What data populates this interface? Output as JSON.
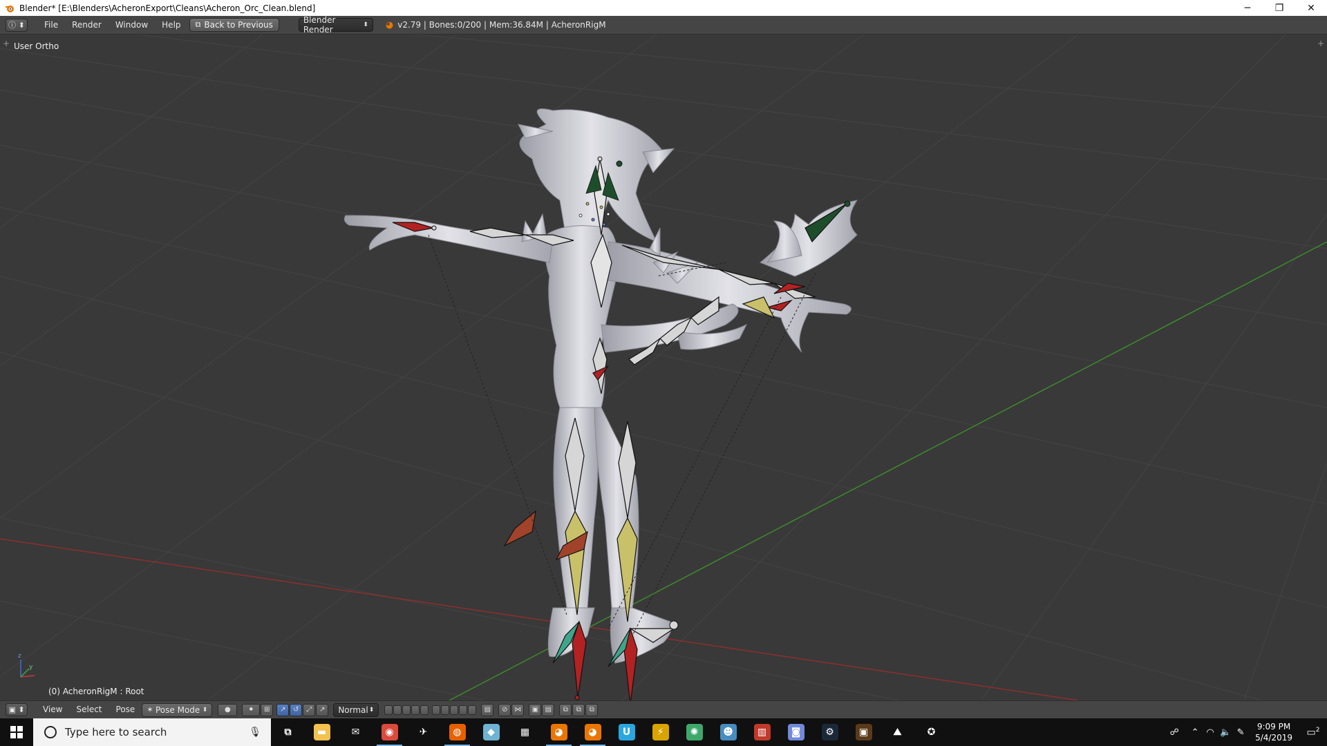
{
  "window": {
    "title": "Blender* [E:\\Blenders\\AcheronExport\\Cleans\\Acheron_Orc_Clean.blend]",
    "controls": [
      "minimize-icon",
      "restore-icon",
      "close-icon"
    ],
    "minimize_glyph": "─",
    "restore_glyph": "❐",
    "close_glyph": "✕"
  },
  "info_header": {
    "editor_type_icon": "info-icon",
    "editor_glyph": "ⓘ ⬍",
    "menu": [
      "File",
      "Render",
      "Window",
      "Help"
    ],
    "back_button": "Back to Previous",
    "render_engine": "Blender Render",
    "stats": "v2.79 | Bones:0/200 | Mem:36.84M | AcheronRigM"
  },
  "viewport": {
    "view_label": "User Ortho",
    "object_label": "(0) AcheronRigM : Root",
    "axis_labels": {
      "z": "z",
      "y": "y"
    },
    "colors": {
      "background": "#393939",
      "grid": "#474747",
      "x_axis": "#8e2e2e",
      "y_axis": "#3e8a2e",
      "mesh": "#c8c8cc",
      "bone": "#d6d6d6",
      "bone_yellow": "#c9c06a",
      "bone_red": "#b22222",
      "bone_green": "#1e4d2b",
      "bone_teal": "#3fa58a"
    }
  },
  "view3d_header": {
    "editor_glyph": "▣ ⬍",
    "menu": [
      "View",
      "Select",
      "Pose"
    ],
    "mode": "Pose Mode",
    "pivot_label": "Normal"
  },
  "taskbar": {
    "search_placeholder": "Type here to search",
    "apps": [
      {
        "name": "task-view",
        "glyph": "⧉",
        "color": "#101010"
      },
      {
        "name": "file-explorer",
        "glyph": "▬",
        "color": "#f2c14e"
      },
      {
        "name": "mail",
        "glyph": "✉",
        "color": "#101010"
      },
      {
        "name": "chrome",
        "glyph": "◉",
        "color": "#d94b3d"
      },
      {
        "name": "app-plane",
        "glyph": "✈",
        "color": "#101010"
      },
      {
        "name": "firefox",
        "glyph": "◍",
        "color": "#e66000"
      },
      {
        "name": "app-blue",
        "glyph": "◆",
        "color": "#6fb3d2"
      },
      {
        "name": "calculator",
        "glyph": "▦",
        "color": "#101010"
      },
      {
        "name": "blender",
        "glyph": "◕",
        "color": "#ea7600"
      },
      {
        "name": "blender-2",
        "glyph": "◕",
        "color": "#ea7600"
      },
      {
        "name": "app-u",
        "glyph": "U",
        "color": "#2aa7df"
      },
      {
        "name": "app-bolt",
        "glyph": "⚡",
        "color": "#d9a400"
      },
      {
        "name": "app-green",
        "glyph": "✺",
        "color": "#3ea86b"
      },
      {
        "name": "app-godot",
        "glyph": "☻",
        "color": "#478cbf"
      },
      {
        "name": "app-piano",
        "glyph": "▥",
        "color": "#c0392b"
      },
      {
        "name": "discord",
        "glyph": "◙",
        "color": "#7289da"
      },
      {
        "name": "steam",
        "glyph": "⚙",
        "color": "#1b2838"
      },
      {
        "name": "app-dark",
        "glyph": "▣",
        "color": "#5a3a1a"
      },
      {
        "name": "photos",
        "glyph": "⛰",
        "color": "#101010"
      },
      {
        "name": "app-wheel",
        "glyph": "✪",
        "color": "#101010"
      }
    ],
    "tray_icons": [
      "people-icon",
      "chevron-up-icon",
      "wifi-icon",
      "volume-icon",
      "pen-icon"
    ],
    "tray_glyphs": [
      "☍",
      "⌃",
      "◠",
      "🔈",
      "✎"
    ],
    "time": "9:09 PM",
    "date": "5/4/2019",
    "notification_count": "2"
  }
}
